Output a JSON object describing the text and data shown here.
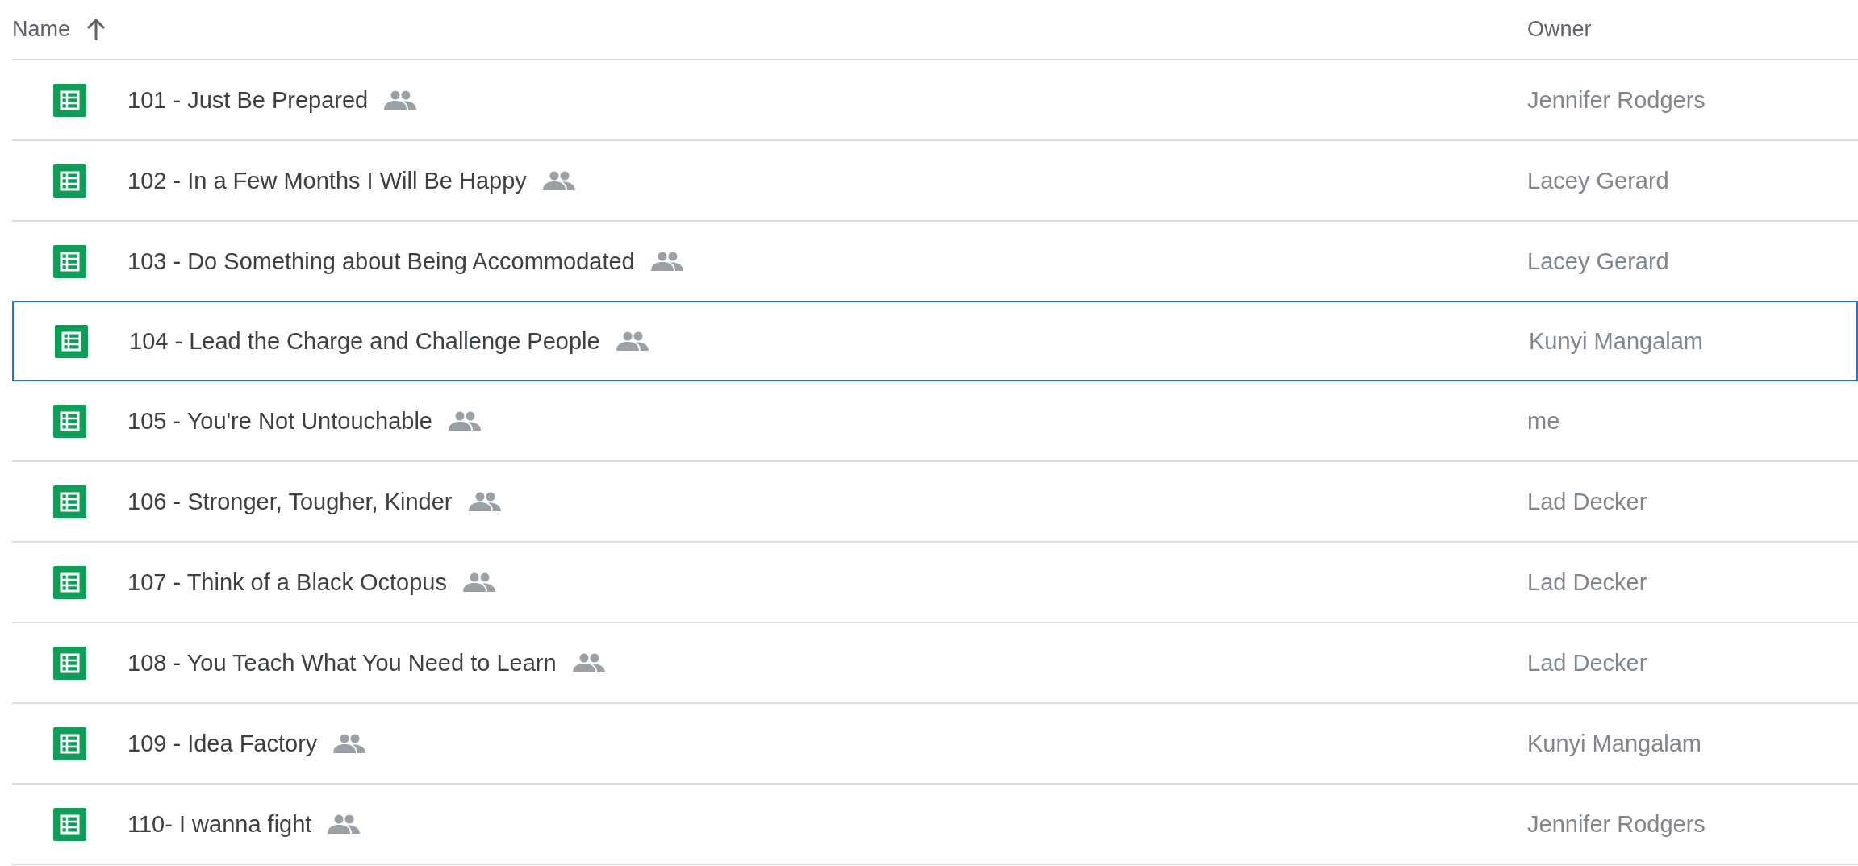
{
  "table": {
    "columns": [
      {
        "label": "Name",
        "sorted": true
      },
      {
        "label": "Owner"
      }
    ],
    "rows": [
      {
        "name": "101 - Just Be Prepared",
        "shared": true,
        "owner": "Jennifer Rodgers",
        "selected": false
      },
      {
        "name": "102 - In a Few Months I Will Be Happy",
        "shared": true,
        "owner": "Lacey Gerard",
        "selected": false
      },
      {
        "name": "103 - Do Something about Being Accommodated",
        "shared": true,
        "owner": "Lacey Gerard",
        "selected": false
      },
      {
        "name": "104 - Lead the Charge and Challenge People",
        "shared": true,
        "owner": "Kunyi Mangalam",
        "selected": true
      },
      {
        "name": "105 - You're Not Untouchable",
        "shared": true,
        "owner": "me",
        "selected": false
      },
      {
        "name": "106 - Stronger, Tougher, Kinder",
        "shared": true,
        "owner": "Lad Decker",
        "selected": false
      },
      {
        "name": "107 - Think of a Black Octopus",
        "shared": true,
        "owner": "Lad Decker",
        "selected": false
      },
      {
        "name": "108 - You Teach What You Need to Learn",
        "shared": true,
        "owner": "Lad Decker",
        "selected": false
      },
      {
        "name": "109 - Idea Factory",
        "shared": true,
        "owner": "Kunyi Mangalam",
        "selected": false
      },
      {
        "name": "110- I wanna fight",
        "shared": true,
        "owner": "Jennifer Rodgers",
        "selected": false
      }
    ]
  }
}
